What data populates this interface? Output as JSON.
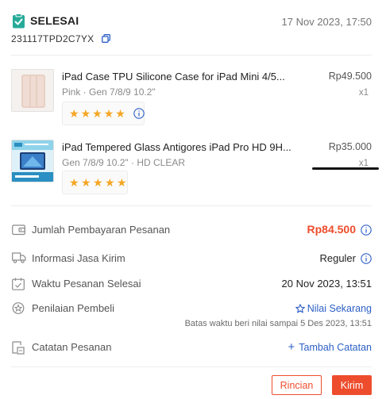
{
  "order": {
    "status": "SELESAI",
    "date": "17 Nov 2023, 17:50",
    "id": "231117TPD2C7YX"
  },
  "items": [
    {
      "title": "iPad Case TPU Silicone Case for iPad Mini 4/5...",
      "variant": "Pink · Gen 7/8/9 10.2\"",
      "price": "Rp49.500",
      "qty": "x1",
      "rating_stars": 5
    },
    {
      "title": "iPad Tempered Glass Antigores iPad Pro HD 9H...",
      "variant": "Gen 7/8/9 10.2\" · HD CLEAR",
      "price": "Rp35.000",
      "qty": "x1",
      "rating_stars": 5
    }
  ],
  "summary": {
    "payment_label": "Jumlah Pembayaran Pesanan",
    "payment_value": "Rp84.500",
    "shipping_label": "Informasi Jasa Kirim",
    "shipping_value": "Reguler",
    "completed_label": "Waktu Pesanan Selesai",
    "completed_value": "20 Nov 2023, 13:51",
    "review_label": "Penilaian Pembeli",
    "review_link": "Nilai Sekarang",
    "review_deadline": "Batas waktu beri nilai sampai 5 Des 2023, 13:51",
    "notes_label": "Catatan Pesanan",
    "notes_link": "Tambah Catatan"
  },
  "buttons": {
    "details": "Rincian",
    "send": "Kirim"
  },
  "colors": {
    "accent": "#ee4d2d",
    "status_green": "#26aa99",
    "link_blue": "#2c5fc7",
    "star": "#f5a623"
  }
}
